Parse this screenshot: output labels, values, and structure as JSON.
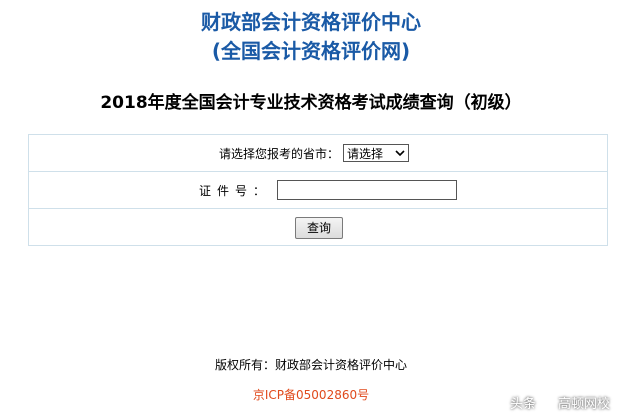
{
  "header": {
    "line1": "财政部会计资格评价中心",
    "line2": "(全国会计资格评价网)"
  },
  "subtitle": "2018年度全国会计专业技术资格考试成绩查询（初级）",
  "form": {
    "province_label": "请选择您报考的省市：",
    "province_selected": "请选择",
    "id_label": "证件号：",
    "id_value": "",
    "submit_label": "查询"
  },
  "footer": {
    "copyright": "版权所有：财政部会计资格评价中心",
    "icp": "京ICP备05002860号"
  },
  "watermark": {
    "prefix": "头条",
    "name": "高顿网校"
  },
  "colors": {
    "header": "#1a5aa6",
    "icp": "#e04a1c",
    "border": "#cfe0ea"
  }
}
